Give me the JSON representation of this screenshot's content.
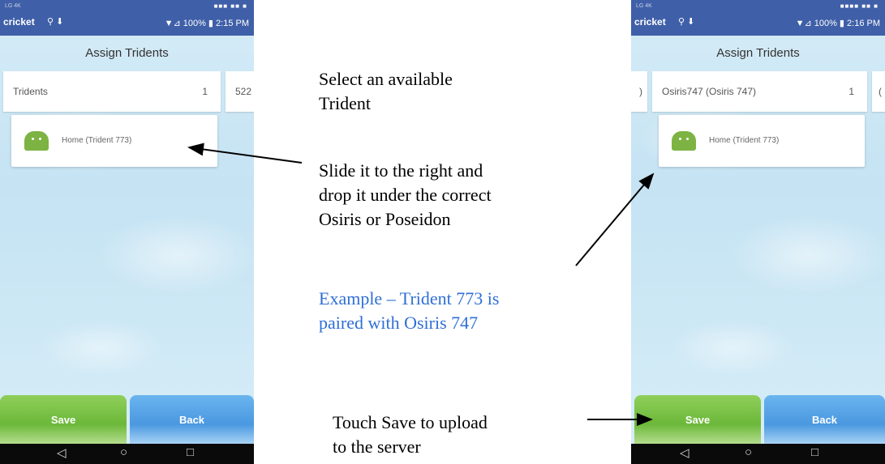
{
  "left_phone": {
    "status": {
      "top_left": "LG 4K",
      "top_right": "■■■ ■■ ■",
      "carrier": "cricket",
      "icons": "⚲ ⬇",
      "right": "▼⊿ 100% ▮ 2:15 PM"
    },
    "title": "Assign Tridents",
    "columns": [
      {
        "name": "Tridents",
        "count": "1"
      },
      {
        "name": "522",
        "count": ""
      }
    ],
    "card_label": "Home (Trident 773)",
    "save_label": "Save",
    "back_label": "Back",
    "nav": {
      "back": "◁",
      "home": "○",
      "recents": "□"
    }
  },
  "right_phone": {
    "status": {
      "top_left": "LG 4K",
      "top_right": "■■■■ ■■ ■",
      "carrier": "cricket",
      "icons": "⚲ ⬇",
      "right": "▼⊿ 100% ▮ 2:16 PM"
    },
    "title": "Assign Tridents",
    "columns": [
      {
        "name": ")",
        "count": ""
      },
      {
        "name": "Osiris747 (Osiris 747)",
        "count": "1"
      },
      {
        "name": "(",
        "count": ""
      }
    ],
    "card_label": "Home (Trident 773)",
    "save_label": "Save",
    "back_label": "Back",
    "nav": {
      "back": "◁",
      "home": "○",
      "recents": "□"
    }
  },
  "annotations": {
    "select_line1": "Select an available",
    "select_line2": "Trident",
    "slide_line1": "Slide it to the right and",
    "slide_line2": "drop it under the correct",
    "slide_line3": "Osiris or Poseidon",
    "example_line1": "Example – Trident 773 is",
    "example_line2": "paired with Osiris 747",
    "save_line1": "Touch Save to upload",
    "save_line2": "to the server"
  },
  "colors": {
    "status_bar": "#3f5fa8",
    "save": "#6cb83a",
    "back": "#4a98e0",
    "example_text": "#2f6fd6"
  }
}
